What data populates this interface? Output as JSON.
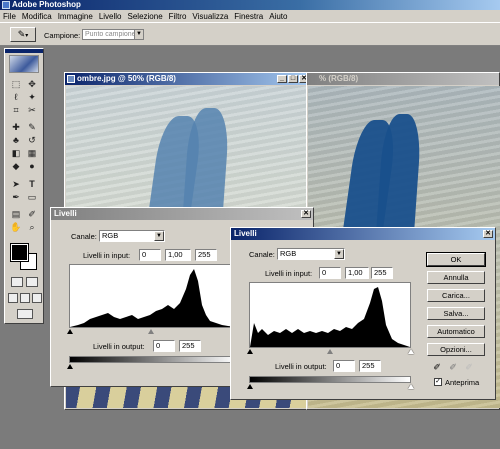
{
  "app": {
    "title": "Adobe Photoshop"
  },
  "menu": [
    "File",
    "Modifica",
    "Immagine",
    "Livello",
    "Selezione",
    "Filtro",
    "Visualizza",
    "Finestra",
    "Aiuto"
  ],
  "options": {
    "label": "Campione:",
    "value": "Punto campione"
  },
  "documents": [
    {
      "title": "ombre.jpg @ 50% (RGB/8)"
    },
    {
      "title": "% (RGB/8)"
    }
  ],
  "dialogs": {
    "back": {
      "title": "Livelli",
      "channel_label": "Canale:",
      "channel_value": "RGB",
      "input_label": "Livelli in input:",
      "input_values": [
        "0",
        "1,00",
        "255"
      ],
      "output_label": "Livelli in output:",
      "output_values": [
        "0",
        "255"
      ]
    },
    "front": {
      "title": "Livelli",
      "channel_label": "Canale:",
      "channel_value": "RGB",
      "input_label": "Livelli in input:",
      "input_values": [
        "0",
        "1,00",
        "255"
      ],
      "output_label": "Livelli in output:",
      "output_values": [
        "0",
        "255"
      ],
      "buttons": {
        "ok": "OK",
        "cancel": "Annulla",
        "load": "Carica...",
        "save": "Salva...",
        "auto": "Automatico",
        "options": "Opzioni..."
      },
      "preview_label": "Anteprima",
      "preview_checked": true
    }
  },
  "close_glyph": "✕",
  "minimize_glyph": "_",
  "maximize_glyph": "□",
  "dropdown_glyph": "▼",
  "check_glyph": "✓"
}
